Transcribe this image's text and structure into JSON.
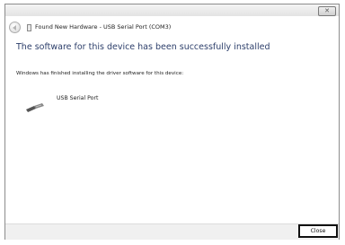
{
  "window": {
    "title": "Found New Hardware - USB Serial Port (COM3)",
    "close_glyph": "✕"
  },
  "content": {
    "heading": "The software for this device has been successfully installed",
    "info": "Windows has finished installing the driver software for this device:",
    "device": {
      "label": "USB Serial Port",
      "icon": "usb-connector-icon"
    }
  },
  "footer": {
    "close_label": "Close"
  }
}
